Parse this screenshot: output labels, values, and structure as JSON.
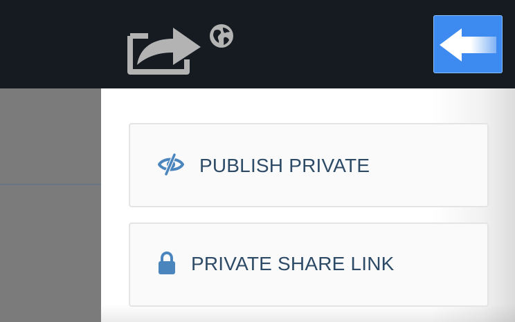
{
  "header": {
    "share_icon": "share-arrow-icon",
    "globe_icon": "globe-icon",
    "back_button_icon": "arrow-left-icon"
  },
  "options": [
    {
      "label": "PUBLISH PRIVATE",
      "icon": "eye-slash-icon"
    },
    {
      "label": "PRIVATE SHARE LINK",
      "icon": "lock-icon"
    }
  ],
  "colors": {
    "topbar": "#161b21",
    "back_button": "#3d8bf0",
    "option_text": "#2d4b67",
    "option_icon": "#4a86bd",
    "overlay": "#7a7a7a"
  }
}
